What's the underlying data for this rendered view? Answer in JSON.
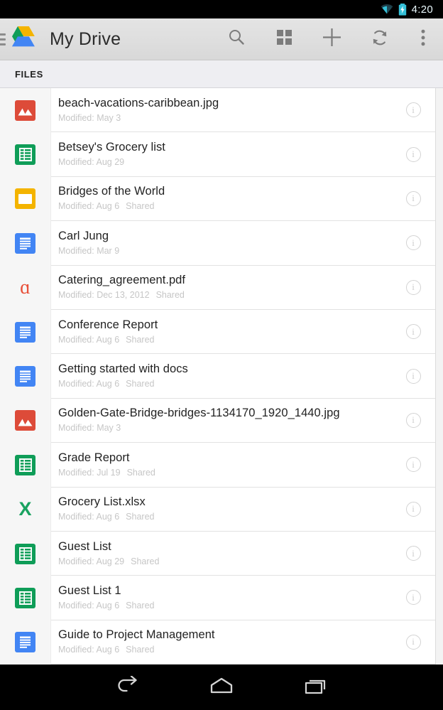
{
  "status_bar": {
    "time": "4:20",
    "icons": [
      "wifi-icon",
      "battery-charging-icon"
    ],
    "accent_color": "#35c0d8"
  },
  "action_bar": {
    "menu_icon": "hamburger-menu-icon",
    "logo": "google-drive-logo",
    "title": "My Drive",
    "actions": [
      {
        "name": "search-button",
        "icon": "search-icon"
      },
      {
        "name": "grid-view-button",
        "icon": "grid-view-icon"
      },
      {
        "name": "add-button",
        "icon": "plus-icon"
      },
      {
        "name": "refresh-button",
        "icon": "refresh-icon"
      },
      {
        "name": "overflow-menu-button",
        "icon": "more-vertical-icon"
      }
    ]
  },
  "tabs": [
    {
      "label": "FILES",
      "selected": true
    }
  ],
  "file_list": {
    "modified_prefix": "Modified:",
    "shared_label": "Shared",
    "info_glyph": "i",
    "items": [
      {
        "name": "beach-vacations-caribbean.jpg",
        "modified": "Modified: May 3",
        "shared": "",
        "type": "image"
      },
      {
        "name": "Betsey's Grocery list",
        "modified": "Modified: Aug 29",
        "shared": "",
        "type": "sheet"
      },
      {
        "name": "Bridges of the World",
        "modified": "Modified: Aug 6",
        "shared": "Shared",
        "type": "slide"
      },
      {
        "name": "Carl Jung",
        "modified": "Modified: Mar 9",
        "shared": "",
        "type": "doc"
      },
      {
        "name": "Catering_agreement.pdf",
        "modified": "Modified: Dec 13, 2012",
        "shared": "Shared",
        "type": "pdf"
      },
      {
        "name": "Conference Report",
        "modified": "Modified: Aug 6",
        "shared": "Shared",
        "type": "doc"
      },
      {
        "name": "Getting started with docs",
        "modified": "Modified: Aug 6",
        "shared": "Shared",
        "type": "doc"
      },
      {
        "name": "Golden-Gate-Bridge-bridges-1134170_1920_1440.jpg",
        "modified": "Modified: May 3",
        "shared": "",
        "type": "image"
      },
      {
        "name": "Grade Report",
        "modified": "Modified: Jul 19",
        "shared": "Shared",
        "type": "sheet"
      },
      {
        "name": "Grocery List.xlsx",
        "modified": "Modified: Aug 6",
        "shared": "Shared",
        "type": "xlsx"
      },
      {
        "name": "Guest List",
        "modified": "Modified: Aug 29",
        "shared": "Shared",
        "type": "sheet"
      },
      {
        "name": "Guest List 1",
        "modified": "Modified: Aug 6",
        "shared": "Shared",
        "type": "sheet"
      },
      {
        "name": "Guide to Project Management",
        "modified": "Modified: Aug 6",
        "shared": "Shared",
        "type": "doc"
      }
    ]
  },
  "nav_bar": {
    "buttons": [
      {
        "name": "back-button",
        "icon": "back-arrow-icon"
      },
      {
        "name": "home-button",
        "icon": "home-icon"
      },
      {
        "name": "recents-button",
        "icon": "recents-icon"
      }
    ]
  },
  "colors": {
    "image_icon": "#dd4b39",
    "sheets_icon": "#0f9d58",
    "slides_icon": "#f4b400",
    "docs_icon": "#4285f4",
    "pdf_icon": "#e8513a",
    "xlsx_icon": "#1aa260"
  }
}
